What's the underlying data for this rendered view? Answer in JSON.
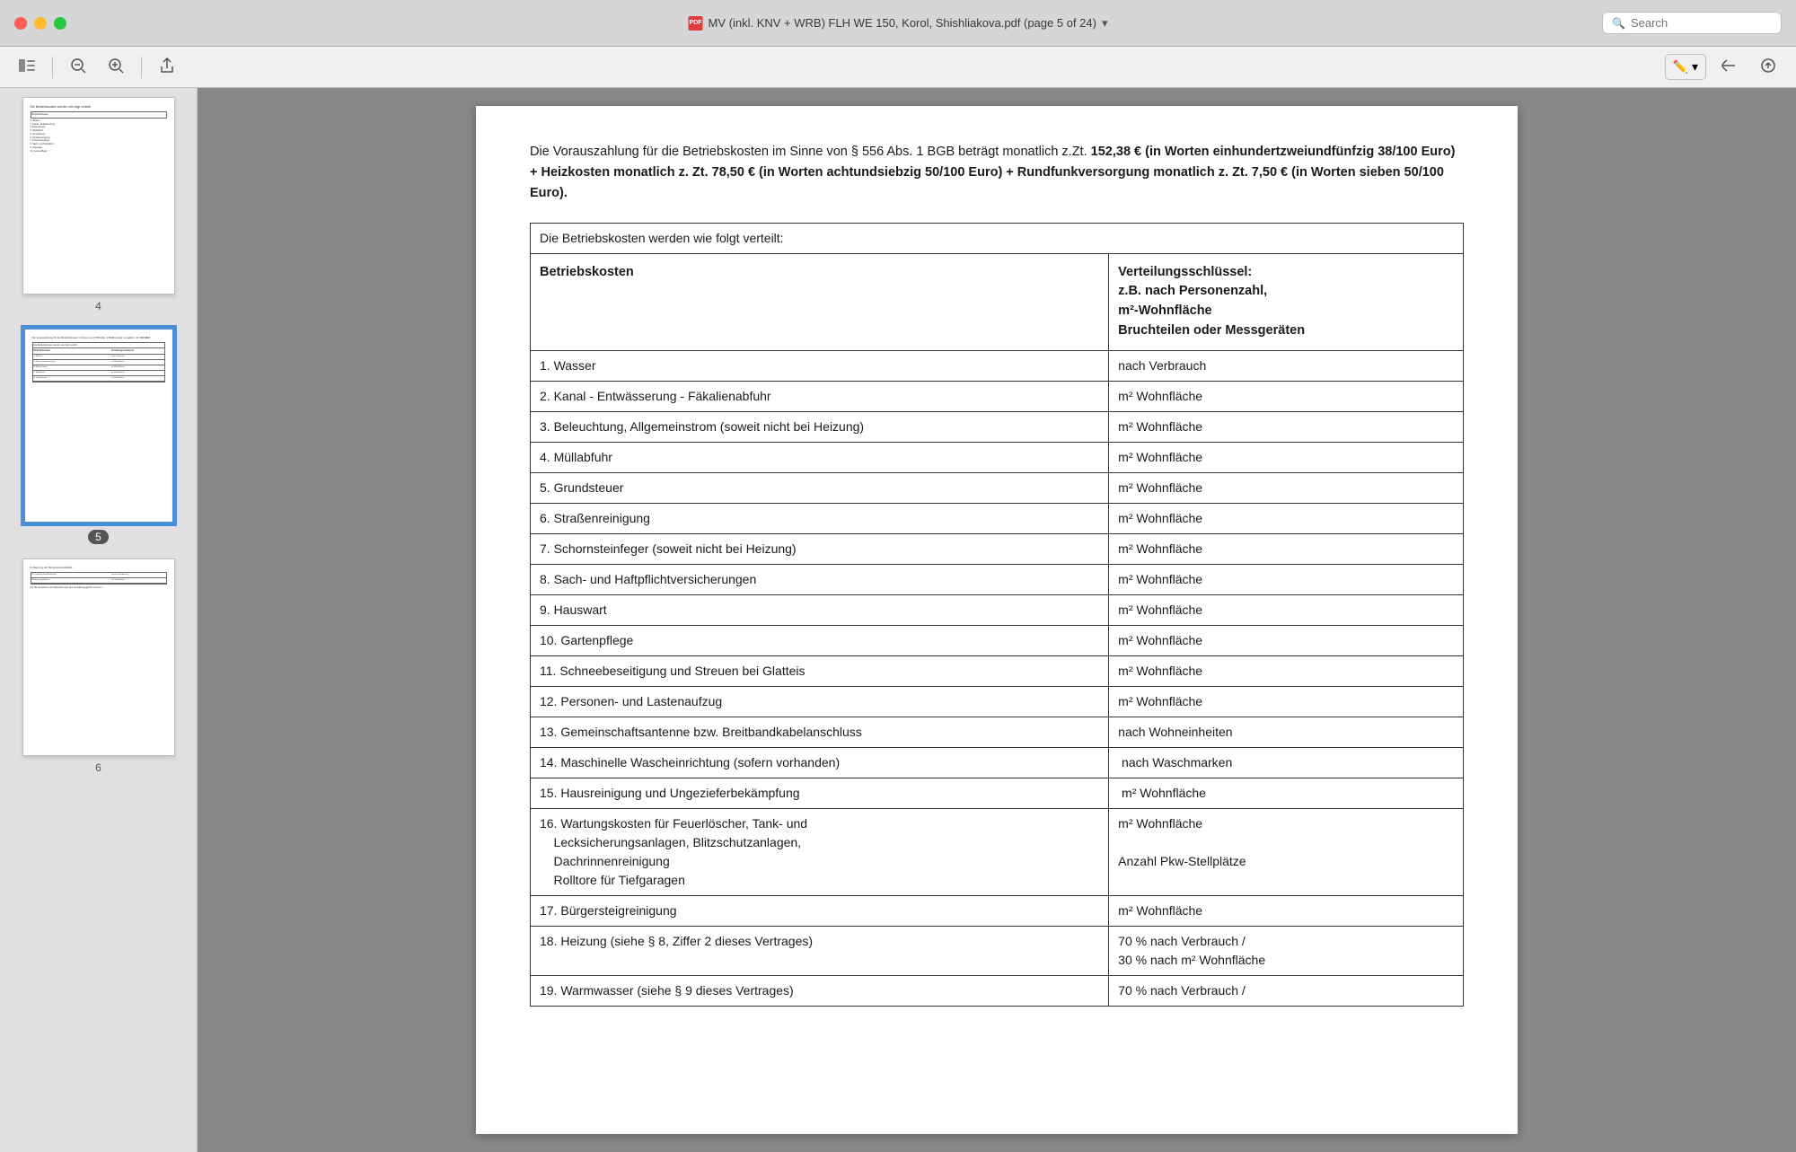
{
  "window": {
    "title": "MV (inkl. KNV + WRB) FLH WE 150, Korol, Shishliakova.pdf (page 5 of 24)",
    "pdf_icon_label": "PDF",
    "chevron": "▾"
  },
  "toolbar": {
    "sidebar_toggle": "☰",
    "zoom_out": "−",
    "zoom_in": "+",
    "share": "↑",
    "annotation_label": "✏",
    "annotation_dropdown": "▾",
    "back": "↩",
    "forward": "→"
  },
  "search": {
    "placeholder": "Search"
  },
  "sidebar": {
    "pages": [
      {
        "number": "4",
        "active": false
      },
      {
        "number": "5",
        "active": true
      },
      {
        "number": "6",
        "active": false
      }
    ]
  },
  "document": {
    "intro_text_parts": [
      "Die Vorauszahlung für die Betriebskosten im Sinne von § 556 Abs. 1 BGB beträgt monatlich z.Zt.",
      " 152,38 € (in Worten einhundertzweiundfünfzig 38/100 Euro) + Heizkosten monatlich z. Zt. 78,50 € (in Worten achtundsiebzig 50/100 Euro) + Rundfunkversorgung monatlich z. Zt. 7,50 € (in Worten sieben 50/100 Euro)."
    ],
    "table": {
      "intro_row": "Die Betriebskosten werden wie folgt verteilt:",
      "col1_header": "Betriebskosten",
      "col2_header_lines": [
        "Verteilungsschlüssel:",
        "z.B. nach Personenzahl,",
        "m²-Wohnfläche",
        "Bruchteilen oder Messgeräten"
      ],
      "rows": [
        {
          "col1": "1. Wasser",
          "col2": "nach Verbrauch"
        },
        {
          "col1": "2. Kanal - Entwässerung - Fäkalienabfuhr",
          "col2": "m² Wohnfläche"
        },
        {
          "col1": "3. Beleuchtung, Allgemeinstrom (soweit nicht bei Heizung)",
          "col2": "m² Wohnfläche"
        },
        {
          "col1": "4. Müllabfuhr",
          "col2": "m² Wohnfläche"
        },
        {
          "col1": "5. Grundsteuer",
          "col2": "m² Wohnfläche"
        },
        {
          "col1": "6. Straßenreinigung",
          "col2": "m² Wohnfläche"
        },
        {
          "col1": "7. Schornsteinfeger (soweit nicht bei Heizung)",
          "col2": "m² Wohnfläche"
        },
        {
          "col1": "8. Sach- und Haftpflichtversicherungen",
          "col2": "m² Wohnfläche"
        },
        {
          "col1": "9. Hauswart",
          "col2": "m² Wohnfläche"
        },
        {
          "col1": "10. Gartenpflege",
          "col2": "m² Wohnfläche"
        },
        {
          "col1": "11. Schneebeseitigung und Streuen bei Glatteis",
          "col2": "m² Wohnfläche"
        },
        {
          "col1": "12. Personen- und Lastenaufzug",
          "col2": "m² Wohnfläche"
        },
        {
          "col1": "13. Gemeinschaftsantenne bzw. Breitbandkabelanschluss",
          "col2": "nach Wohneinheiten"
        },
        {
          "col1": "14. Maschinelle Wascheinrichtung (sofern vorhanden)",
          "col2": " nach Waschmarken"
        },
        {
          "col1": "15. Hausreinigung und Ungezieferbekämpfung",
          "col2": " m² Wohnfläche"
        },
        {
          "col1": "16. Wartungskosten für Feuerlöscher, Tank- und Lecksicherungsanlagen, Blitzschutzanlagen, Dachrinnenreinigung\nRolltore für Tiefgaragen",
          "col2": "m² Wohnfläche\n\nAnzahl Pkw-Stellplätze"
        },
        {
          "col1": "17. Bürgersteigreinigung",
          "col2": "m² Wohnfläche"
        },
        {
          "col1": "18. Heizung (siehe § 8, Ziffer 2 dieses Vertrages)",
          "col2": "70 % nach Verbrauch /\n30 % nach m² Wohnfläche"
        },
        {
          "col1": "19. Warmwasser (siehe § 9 dieses Vertrages)",
          "col2": "70 % nach Verbrauch /"
        }
      ]
    }
  }
}
